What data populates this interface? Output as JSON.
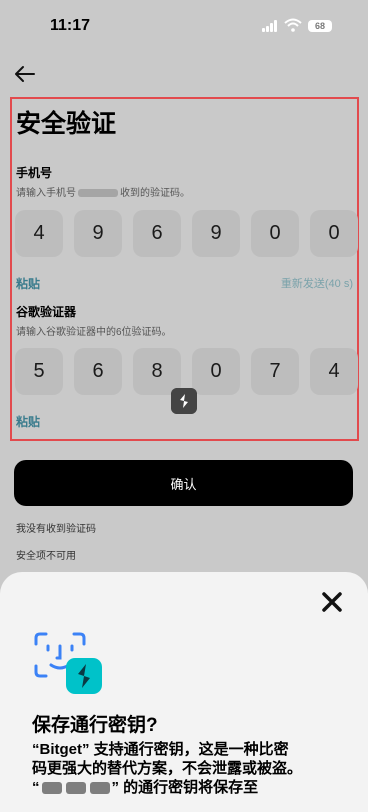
{
  "status_bar": {
    "time": "11:17",
    "battery": "68"
  },
  "page": {
    "title": "安全验证"
  },
  "phone": {
    "label": "手机号",
    "hint_prefix": "请输入手机号",
    "hint_suffix": "收到的验证码。",
    "code": [
      "4",
      "9",
      "6",
      "9",
      "0",
      "0"
    ],
    "paste_label": "粘贴",
    "resend_label": "重新发送(40 s)"
  },
  "google": {
    "label": "谷歌验证器",
    "hint": "请输入谷歌验证器中的6位验证码。",
    "code": [
      "5",
      "6",
      "8",
      "0",
      "7",
      "4"
    ],
    "paste_label": "粘贴"
  },
  "confirm_label": "确认",
  "links": {
    "no_code": "我没有收到验证码",
    "unavailable": "安全项不可用"
  },
  "sheet": {
    "title": "保存通行密钥?",
    "line1": "“Bitget” 支持通行密钥，这是一种比密",
    "line2": "码更强大的替代方案，不会泄露或被盗。",
    "line3_open": "“",
    "line3_close": "” 的通行密钥将保存至"
  },
  "colors": {
    "accent": "#3a7c8d",
    "highlight_border": "#e24a4d",
    "brand": "#00c2c9"
  }
}
